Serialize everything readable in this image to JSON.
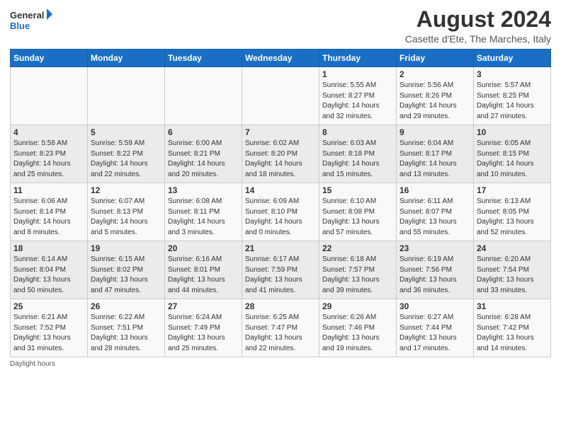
{
  "logo": {
    "line1": "General",
    "line2": "Blue"
  },
  "title": "August 2024",
  "subtitle": "Casette d'Ete, The Marches, Italy",
  "weekdays": [
    "Sunday",
    "Monday",
    "Tuesday",
    "Wednesday",
    "Thursday",
    "Friday",
    "Saturday"
  ],
  "weeks": [
    [
      {
        "day": "",
        "info": ""
      },
      {
        "day": "",
        "info": ""
      },
      {
        "day": "",
        "info": ""
      },
      {
        "day": "",
        "info": ""
      },
      {
        "day": "1",
        "info": "Sunrise: 5:55 AM\nSunset: 8:27 PM\nDaylight: 14 hours and 32 minutes."
      },
      {
        "day": "2",
        "info": "Sunrise: 5:56 AM\nSunset: 8:26 PM\nDaylight: 14 hours and 29 minutes."
      },
      {
        "day": "3",
        "info": "Sunrise: 5:57 AM\nSunset: 8:25 PM\nDaylight: 14 hours and 27 minutes."
      }
    ],
    [
      {
        "day": "4",
        "info": "Sunrise: 5:58 AM\nSunset: 8:23 PM\nDaylight: 14 hours and 25 minutes."
      },
      {
        "day": "5",
        "info": "Sunrise: 5:59 AM\nSunset: 8:22 PM\nDaylight: 14 hours and 22 minutes."
      },
      {
        "day": "6",
        "info": "Sunrise: 6:00 AM\nSunset: 8:21 PM\nDaylight: 14 hours and 20 minutes."
      },
      {
        "day": "7",
        "info": "Sunrise: 6:02 AM\nSunset: 8:20 PM\nDaylight: 14 hours and 18 minutes."
      },
      {
        "day": "8",
        "info": "Sunrise: 6:03 AM\nSunset: 8:18 PM\nDaylight: 14 hours and 15 minutes."
      },
      {
        "day": "9",
        "info": "Sunrise: 6:04 AM\nSunset: 8:17 PM\nDaylight: 14 hours and 13 minutes."
      },
      {
        "day": "10",
        "info": "Sunrise: 6:05 AM\nSunset: 8:15 PM\nDaylight: 14 hours and 10 minutes."
      }
    ],
    [
      {
        "day": "11",
        "info": "Sunrise: 6:06 AM\nSunset: 8:14 PM\nDaylight: 14 hours and 8 minutes."
      },
      {
        "day": "12",
        "info": "Sunrise: 6:07 AM\nSunset: 8:13 PM\nDaylight: 14 hours and 5 minutes."
      },
      {
        "day": "13",
        "info": "Sunrise: 6:08 AM\nSunset: 8:11 PM\nDaylight: 14 hours and 3 minutes."
      },
      {
        "day": "14",
        "info": "Sunrise: 6:09 AM\nSunset: 8:10 PM\nDaylight: 14 hours and 0 minutes."
      },
      {
        "day": "15",
        "info": "Sunrise: 6:10 AM\nSunset: 8:08 PM\nDaylight: 13 hours and 57 minutes."
      },
      {
        "day": "16",
        "info": "Sunrise: 6:11 AM\nSunset: 8:07 PM\nDaylight: 13 hours and 55 minutes."
      },
      {
        "day": "17",
        "info": "Sunrise: 6:13 AM\nSunset: 8:05 PM\nDaylight: 13 hours and 52 minutes."
      }
    ],
    [
      {
        "day": "18",
        "info": "Sunrise: 6:14 AM\nSunset: 8:04 PM\nDaylight: 13 hours and 50 minutes."
      },
      {
        "day": "19",
        "info": "Sunrise: 6:15 AM\nSunset: 8:02 PM\nDaylight: 13 hours and 47 minutes."
      },
      {
        "day": "20",
        "info": "Sunrise: 6:16 AM\nSunset: 8:01 PM\nDaylight: 13 hours and 44 minutes."
      },
      {
        "day": "21",
        "info": "Sunrise: 6:17 AM\nSunset: 7:59 PM\nDaylight: 13 hours and 41 minutes."
      },
      {
        "day": "22",
        "info": "Sunrise: 6:18 AM\nSunset: 7:57 PM\nDaylight: 13 hours and 39 minutes."
      },
      {
        "day": "23",
        "info": "Sunrise: 6:19 AM\nSunset: 7:56 PM\nDaylight: 13 hours and 36 minutes."
      },
      {
        "day": "24",
        "info": "Sunrise: 6:20 AM\nSunset: 7:54 PM\nDaylight: 13 hours and 33 minutes."
      }
    ],
    [
      {
        "day": "25",
        "info": "Sunrise: 6:21 AM\nSunset: 7:52 PM\nDaylight: 13 hours and 31 minutes."
      },
      {
        "day": "26",
        "info": "Sunrise: 6:22 AM\nSunset: 7:51 PM\nDaylight: 13 hours and 28 minutes."
      },
      {
        "day": "27",
        "info": "Sunrise: 6:24 AM\nSunset: 7:49 PM\nDaylight: 13 hours and 25 minutes."
      },
      {
        "day": "28",
        "info": "Sunrise: 6:25 AM\nSunset: 7:47 PM\nDaylight: 13 hours and 22 minutes."
      },
      {
        "day": "29",
        "info": "Sunrise: 6:26 AM\nSunset: 7:46 PM\nDaylight: 13 hours and 19 minutes."
      },
      {
        "day": "30",
        "info": "Sunrise: 6:27 AM\nSunset: 7:44 PM\nDaylight: 13 hours and 17 minutes."
      },
      {
        "day": "31",
        "info": "Sunrise: 6:28 AM\nSunset: 7:42 PM\nDaylight: 13 hours and 14 minutes."
      }
    ]
  ],
  "footer": "Daylight hours"
}
